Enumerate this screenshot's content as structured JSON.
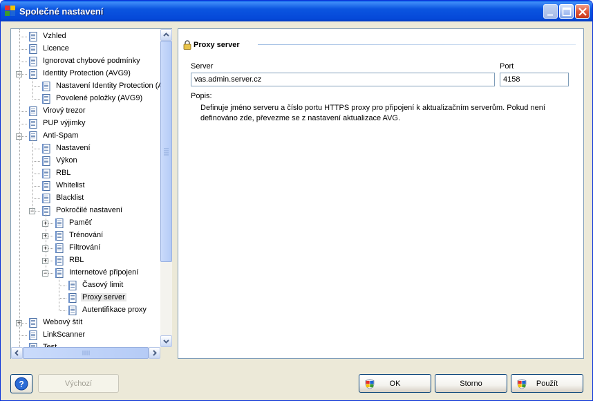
{
  "window": {
    "title": "Společné nastavení"
  },
  "tree": [
    {
      "label": "Vzhled",
      "level": 0
    },
    {
      "label": "Licence",
      "level": 0
    },
    {
      "label": "Ignorovat chybové podmínky",
      "level": 0
    },
    {
      "label": "Identity Protection (AVG9)",
      "level": 0,
      "expander": "minus"
    },
    {
      "label": "Nastavení Identity Protection (A",
      "level": 1
    },
    {
      "label": "Povolené položky (AVG9)",
      "level": 1
    },
    {
      "label": "Virový trezor",
      "level": 0
    },
    {
      "label": "PUP výjimky",
      "level": 0
    },
    {
      "label": "Anti-Spam",
      "level": 0,
      "expander": "minus"
    },
    {
      "label": "Nastavení",
      "level": 1
    },
    {
      "label": "Výkon",
      "level": 1
    },
    {
      "label": "RBL",
      "level": 1
    },
    {
      "label": "Whitelist",
      "level": 1
    },
    {
      "label": "Blacklist",
      "level": 1
    },
    {
      "label": "Pokročilé nastavení",
      "level": 1,
      "expander": "minus"
    },
    {
      "label": "Paměť",
      "level": 2,
      "expander": "plus"
    },
    {
      "label": "Trénování",
      "level": 2,
      "expander": "plus"
    },
    {
      "label": "Filtrování",
      "level": 2,
      "expander": "plus"
    },
    {
      "label": "RBL",
      "level": 2,
      "expander": "plus"
    },
    {
      "label": "Internetové připojení",
      "level": 2,
      "expander": "minus"
    },
    {
      "label": "Časový limit",
      "level": 3
    },
    {
      "label": "Proxy server",
      "level": 3,
      "selected": true
    },
    {
      "label": "Autentifikace proxy",
      "level": 3
    },
    {
      "label": "Webový štít",
      "level": 0,
      "expander": "plus"
    },
    {
      "label": "LinkScanner",
      "level": 0
    },
    {
      "label": "Test",
      "level": 0
    }
  ],
  "panel": {
    "title": "Proxy server",
    "server_label": "Server",
    "server_value": "vas.admin.server.cz",
    "port_label": "Port",
    "port_value": "4158",
    "desc_label": "Popis:",
    "description": "Definuje jméno serveru a číslo portu HTTPS proxy pro připojení k aktualizačním serverům. Pokud není definováno zde, převezme se z nastavení aktualizace AVG."
  },
  "buttons": {
    "default": "Výchozí",
    "ok": "OK",
    "cancel": "Storno",
    "apply": "Použít"
  },
  "colors": {
    "titlebar": "#0548d8",
    "accent": "#003c74"
  }
}
